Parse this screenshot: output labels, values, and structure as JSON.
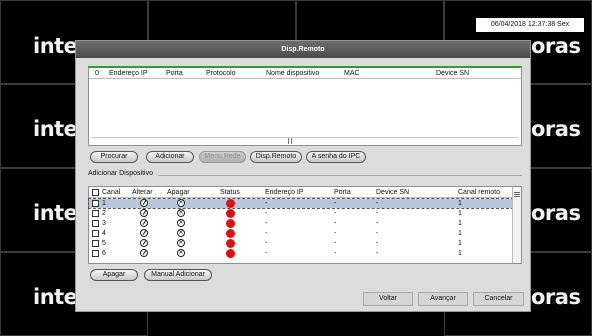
{
  "clock": "06/04/2018 12:37:38 Sex",
  "background": {
    "logo_text": "intelbras"
  },
  "dialog": {
    "title": "Disp.Remoto",
    "search_table": {
      "headers": [
        "0",
        "Endereço IP",
        "Porta",
        "Protocolo",
        "Nome dispositivo",
        "MAC",
        "Device SN"
      ]
    },
    "buttons": {
      "procurar": "Procurar",
      "adicionar": "Adicionar",
      "menu_rede": "Menu Rede",
      "disp_remoto": "Disp.Remoto",
      "senha_ipc": "A senha do IPC"
    },
    "section_label": "Adicionar Dispositivo",
    "added_table": {
      "headers": [
        "Canal",
        "Alterar",
        "Apagar",
        "Status",
        "Endereço IP",
        "Porta",
        "Device SN",
        "Canal remoto"
      ],
      "rows": [
        {
          "canal": "1",
          "ip": "-",
          "porta": "-",
          "sn": "-",
          "remoto": "1",
          "selected": true
        },
        {
          "canal": "2",
          "ip": "-",
          "porta": "-",
          "sn": "-",
          "remoto": "1"
        },
        {
          "canal": "3",
          "ip": "-",
          "porta": "-",
          "sn": "-",
          "remoto": "1"
        },
        {
          "canal": "4",
          "ip": "-",
          "porta": "-",
          "sn": "-",
          "remoto": "1"
        },
        {
          "canal": "5",
          "ip": "-",
          "porta": "-",
          "sn": "-",
          "remoto": "1"
        },
        {
          "canal": "6",
          "ip": "-",
          "porta": "-",
          "sn": "-",
          "remoto": "1"
        }
      ],
      "status_color": "#e01010"
    },
    "bottom_buttons": {
      "apagar": "Apagar",
      "manual_adicionar": "Manual Adicionar"
    },
    "footer_buttons": {
      "voltar": "Voltar",
      "avancar": "Avançar",
      "cancelar": "Cancelar"
    }
  }
}
